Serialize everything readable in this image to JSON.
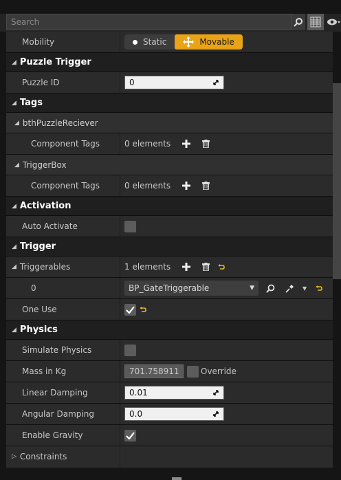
{
  "search": {
    "placeholder": "Search"
  },
  "mobility": {
    "label": "Mobility",
    "options": [
      "Static",
      "Movable"
    ],
    "selected": "Movable"
  },
  "categories": {
    "puzzle_trigger": "Puzzle Trigger",
    "tags": "Tags",
    "activation": "Activation",
    "trigger": "Trigger",
    "physics": "Physics"
  },
  "puzzle_id": {
    "label": "Puzzle ID",
    "value": "0"
  },
  "tags": {
    "sub1": "bthPuzzleReciever",
    "sub2": "TriggerBox",
    "component_tags_label": "Component Tags",
    "component_tags_value": "0 elements"
  },
  "activation": {
    "auto_activate_label": "Auto Activate",
    "checked": false
  },
  "trigger": {
    "triggerables_label": "Triggerables",
    "triggerables_value": "1 elements",
    "index_label": "0",
    "index_value": "BP_GateTriggerable",
    "one_use_label": "One Use",
    "one_use_checked": true
  },
  "physics": {
    "simulate_label": "Simulate Physics",
    "mass_label": "Mass in Kg",
    "mass_value": "701.758911",
    "override_label": "Override",
    "linear_label": "Linear Damping",
    "linear_value": "0.01",
    "angular_label": "Angular Damping",
    "angular_value": "0.0",
    "gravity_label": "Enable Gravity",
    "gravity_checked": true,
    "constraints_label": "Constraints"
  },
  "colors": {
    "accent": "#e8a317",
    "background": "#2b2b2b",
    "category": "#1f1f1f"
  },
  "icons": [
    "search-icon",
    "grid-view-icon",
    "eye-icon",
    "plus-icon",
    "trash-icon",
    "reset-arrow-icon",
    "browse-icon",
    "pick-icon",
    "drag-handle-icon"
  ]
}
